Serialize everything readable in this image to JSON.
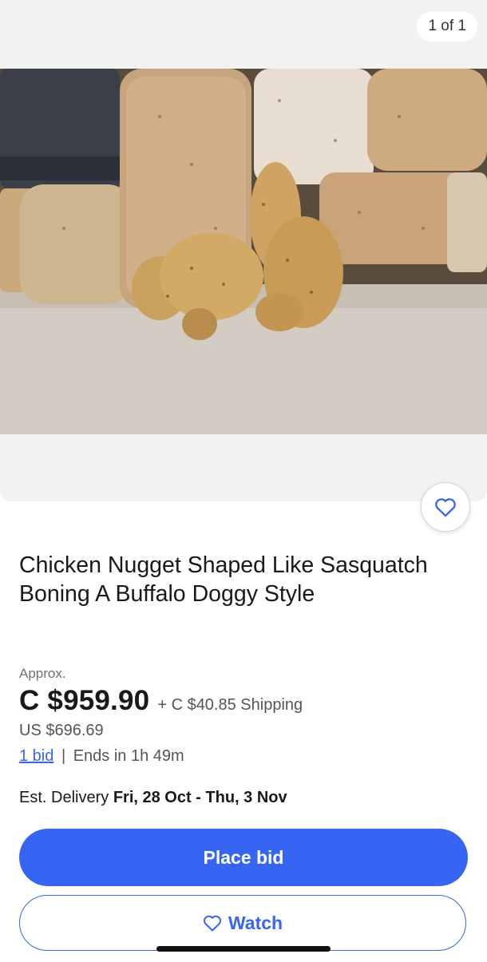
{
  "gallery": {
    "counter": "1 of 1"
  },
  "colors": {
    "accent": "#3665f3",
    "text": "#191919",
    "muted": "#707070",
    "gallery_bg": "#f2f2f2"
  },
  "icons": {
    "favorite": "heart-outline-icon",
    "watch": "heart-outline-icon"
  },
  "listing": {
    "title": "Chicken Nugget Shaped Like Sasquatch Boning A Buffalo Doggy Style",
    "approx_label": "Approx.",
    "price": "C $959.90",
    "shipping": "+ C $40.85 Shipping",
    "usd_price": "US $696.69",
    "bids": "1 bid",
    "separator": "|",
    "ends_in": "Ends in 1h 49m",
    "delivery_label": "Est. Delivery",
    "delivery_dates": "Fri, 28 Oct - Thu, 3 Nov"
  },
  "actions": {
    "place_bid": "Place bid",
    "watch": "Watch"
  }
}
